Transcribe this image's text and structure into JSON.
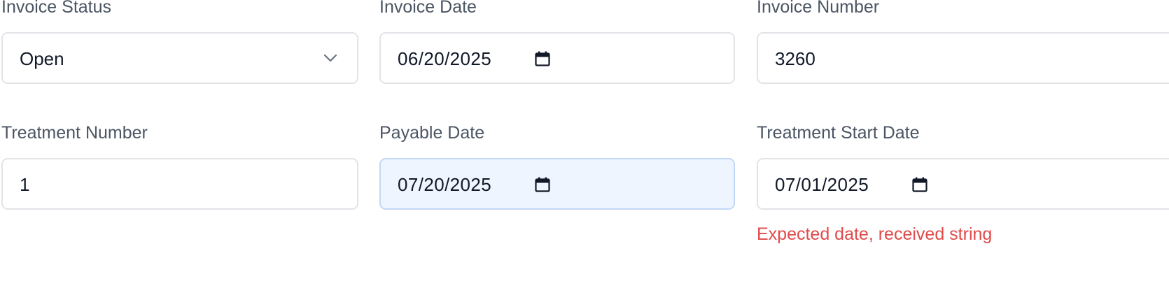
{
  "fields": {
    "invoice_status": {
      "label": "Invoice Status",
      "value": "Open"
    },
    "invoice_date": {
      "label": "Invoice Date",
      "value": "06/20/2025"
    },
    "invoice_number": {
      "label": "Invoice Number",
      "value": "3260"
    },
    "treatment_number": {
      "label": "Treatment Number",
      "value": "1"
    },
    "payable_date": {
      "label": "Payable Date",
      "value": "07/20/2025"
    },
    "treatment_start_date": {
      "label": "Treatment Start Date",
      "value": "07/01/2025",
      "error": "Expected date, received string"
    }
  },
  "icons": {
    "select": "chevron-down-icon",
    "date": "calendar-icon"
  },
  "colors": {
    "label": "#4b5563",
    "value": "#111827",
    "border": "#e2e4e8",
    "focused_background": "#eff5fe",
    "focused_border": "#c2d8f5",
    "error": "#e14a4a"
  }
}
